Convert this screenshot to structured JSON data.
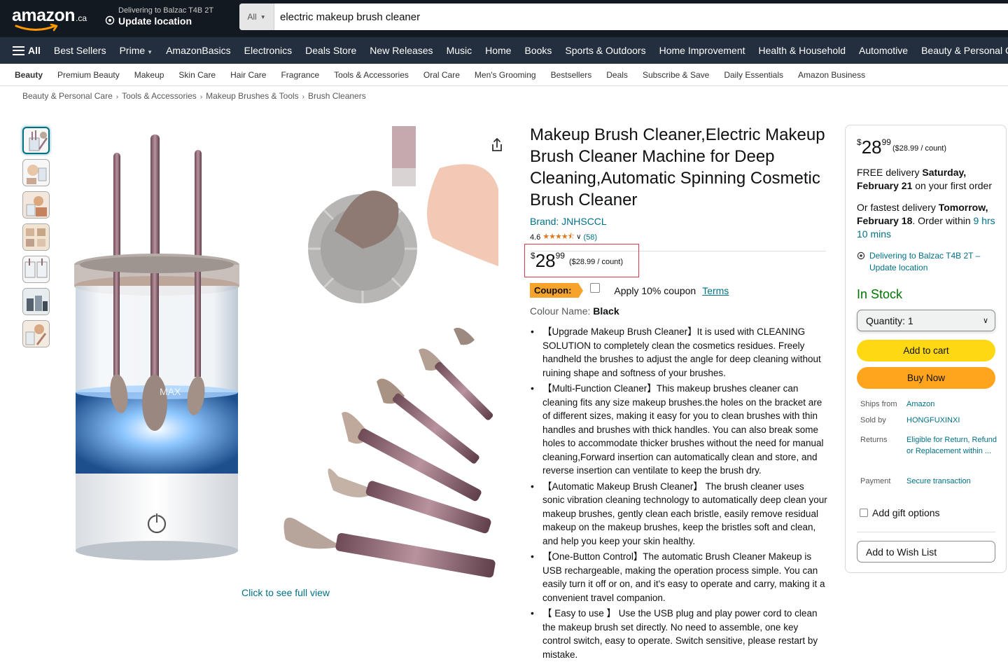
{
  "header": {
    "logo_text": "amazon",
    "logo_suffix": ".ca",
    "deliver_line1": "Delivering to Balzac T4B 2T",
    "deliver_line2": "Update location",
    "search_category": "All",
    "search_value": "electric makeup brush cleaner"
  },
  "nav": {
    "all_label": "All",
    "items": [
      "Best Sellers",
      "Prime",
      "AmazonBasics",
      "Electronics",
      "Deals Store",
      "New Releases",
      "Music",
      "Home",
      "Books",
      "Sports & Outdoors",
      "Home Improvement",
      "Health & Household",
      "Automotive",
      "Beauty & Personal Care"
    ]
  },
  "subnav": {
    "items": [
      "Beauty",
      "Premium Beauty",
      "Makeup",
      "Skin Care",
      "Hair Care",
      "Fragrance",
      "Tools & Accessories",
      "Oral Care",
      "Men's Grooming",
      "Bestsellers",
      "Deals",
      "Subscribe & Save",
      "Daily Essentials",
      "Amazon Business"
    ]
  },
  "breadcrumb": [
    "Beauty & Personal Care",
    "Tools & Accessories",
    "Makeup Brushes & Tools",
    "Brush Cleaners"
  ],
  "gallery": {
    "thumb_count": 7,
    "full_view_label": "Click to see full view",
    "image_watermark": "MAX"
  },
  "product": {
    "title": "Makeup Brush Cleaner,Electric Makeup Brush Cleaner Machine for Deep Cleaning,Automatic Spinning Cosmetic Brush Cleaner",
    "brand": "Brand: JNHSCCL",
    "rating_value": "4.6",
    "rating_stars": "★★★★⯪",
    "rating_count": "(58)",
    "price_symbol": "$",
    "price_whole": "28",
    "price_fraction": "99",
    "price_unit": "($28.99 / count)",
    "coupon_label": "Coupon:",
    "coupon_text": "Apply 10% coupon",
    "coupon_terms": "Terms",
    "colour_label": "Colour Name: ",
    "colour_value": "Black",
    "bullets": [
      "【Upgrade Makeup Brush Cleaner】It is used with CLEANING SOLUTION to completely clean the cosmetics residues. Freely handheld the brushes to adjust the angle for deep cleaning without ruining shape and softness of your brushes.",
      "【Multi-Function Cleaner】This makeup brushes cleaner can cleaning fits any size makeup brushes.the holes on the bracket are of different sizes, making it easy for you to clean brushes with thin handles and brushes with thick handles. You can also break some holes to accommodate thicker brushes without the need for manual cleaning,Forward insertion can automatically clean and store, and reverse insertion can ventilate to keep the brush dry.",
      "【Automatic Makeup Brush Cleaner】 The brush cleaner uses sonic vibration cleaning technology to automatically deep clean your makeup brushes, gently clean each bristle, easily remove residual makeup on the makeup brushes, keep the bristles soft and clean, and help you keep your skin healthy.",
      "【One-Button Control】The automatic Brush Cleaner Makeup is USB rechargeable, making the operation process simple. You can easily turn it off or on, and it's easy to operate and carry, making it a convenient travel companion.",
      "【 Easy to use 】 Use the USB plug and play power cord to clean the makeup brush set directly. No need to assemble, one key control switch, easy to operate. Switch sensitive, please restart by mistake."
    ]
  },
  "buybox": {
    "price_symbol": "$",
    "price_whole": "28",
    "price_fraction": "99",
    "price_unit": "($28.99 / count)",
    "delivery_free": "FREE delivery ",
    "delivery_date": "Saturday, February 21",
    "delivery_suffix": " on your first order",
    "fastest_prefix": "Or fastest delivery ",
    "fastest_date": "Tomorrow, February 18",
    "fastest_mid": ". Order within ",
    "fastest_countdown": "9 hrs 10 mins",
    "location": "Delivering to Balzac T4B 2T – Update location",
    "stock": "In Stock",
    "quantity": "Quantity:  1",
    "add_to_cart": "Add to cart",
    "buy_now": "Buy Now",
    "ships_from_label": "Ships from",
    "ships_from_value": "Amazon",
    "sold_by_label": "Sold by",
    "sold_by_value": "HONGFUXINXI",
    "returns_label": "Returns",
    "returns_value": "Eligible for Return, Refund or Replacement within ...",
    "payment_label": "Payment",
    "payment_value": "Secure transaction",
    "gift_label": "Add gift options",
    "wishlist_label": "Add to Wish List"
  },
  "colors": {
    "topbar": "#131921",
    "navbar": "#232f3e",
    "link": "#007185",
    "cart": "#ffd814",
    "buy": "#ffa41c",
    "coupon": "#f7a22b",
    "stock": "#007600",
    "stars": "#de7921"
  }
}
